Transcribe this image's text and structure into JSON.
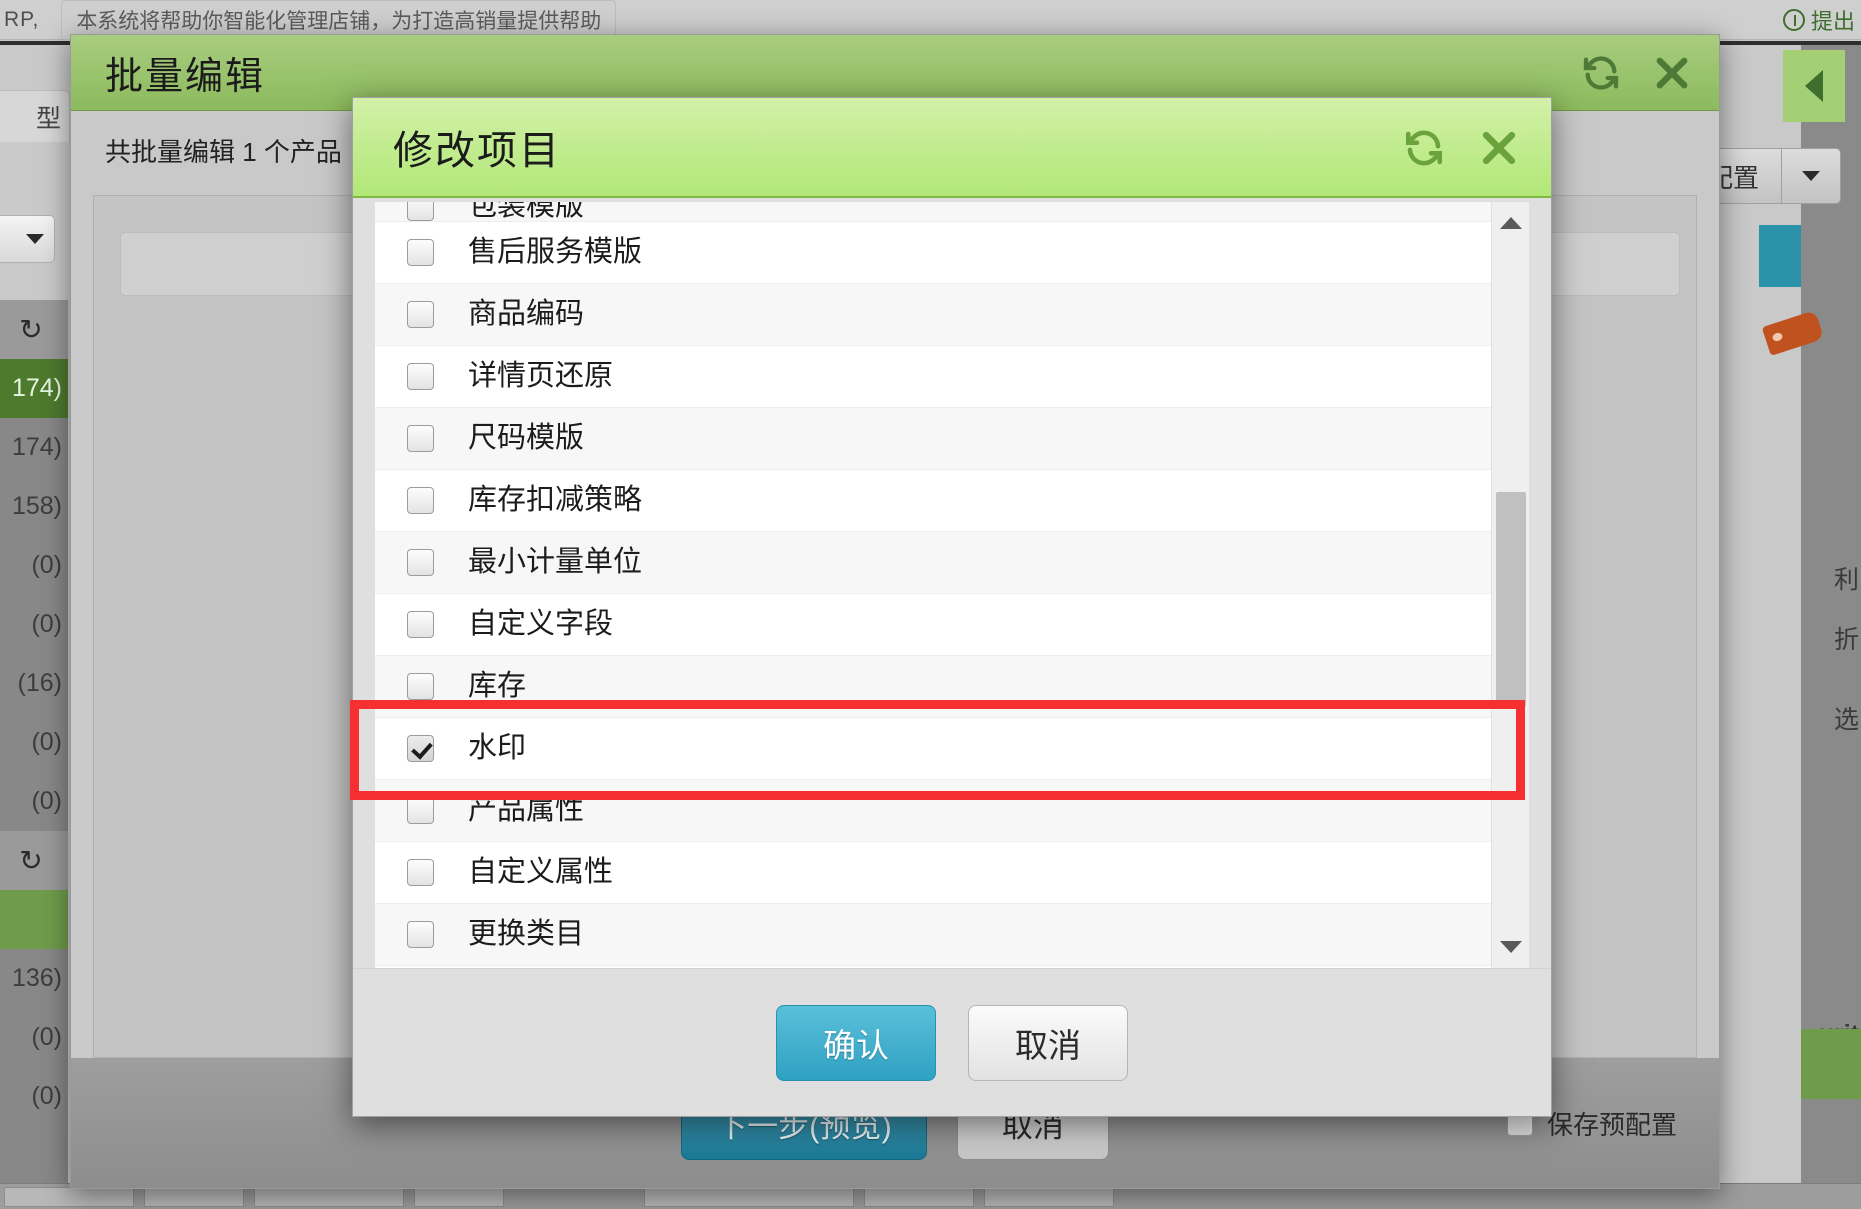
{
  "background": {
    "topbar": {
      "left_text": "RP,",
      "mid_text": "本系统将帮助你智能化管理店铺，为打造高销量提供帮助",
      "right_text": "提出",
      "right_icon": "help-circle-icon"
    },
    "tab_label": "型",
    "left_counts": [
      "174)",
      "174)",
      "158)",
      "(0)",
      "(0)",
      "(16)",
      "(0)",
      "(0)"
    ],
    "left_counts_2": [
      "136)",
      "(0)",
      "(0)"
    ],
    "refresh_icon": "refresh-icon",
    "right_labels": [
      "利",
      "折",
      "选"
    ],
    "right_footer_text": "urit",
    "save_preset_button": {
      "label": "保存预设配置",
      "dropdown_icon": "chevron-down-icon"
    }
  },
  "outer_modal": {
    "title": "批量编辑",
    "refresh_icon": "refresh-icon",
    "close_icon": "close-icon",
    "subtitle": "共批量编辑 1 个产品",
    "footer": {
      "next_label": "下一步(预览)",
      "cancel_label": "取消",
      "save_preset_checkbox_label": "保存预配置",
      "save_preset_checked": false
    }
  },
  "inner_modal": {
    "title": "修改项目",
    "refresh_icon": "refresh-icon",
    "close_icon": "close-icon",
    "items": [
      {
        "label": "包装模版",
        "checked": false,
        "clipped": true
      },
      {
        "label": "售后服务模版",
        "checked": false
      },
      {
        "label": "商品编码",
        "checked": false
      },
      {
        "label": "详情页还原",
        "checked": false
      },
      {
        "label": "尺码模版",
        "checked": false
      },
      {
        "label": "库存扣减策略",
        "checked": false
      },
      {
        "label": "最小计量单位",
        "checked": false
      },
      {
        "label": "自定义字段",
        "checked": false
      },
      {
        "label": "库存",
        "checked": false
      },
      {
        "label": "水印",
        "checked": true
      },
      {
        "label": "产品属性",
        "checked": false
      },
      {
        "label": "自定义属性",
        "checked": false
      },
      {
        "label": "更换类目",
        "checked": false
      }
    ],
    "scrollbar": {
      "up_icon": "triangle-up-icon",
      "down_icon": "triangle-down-icon",
      "thumb": "scroll-thumb"
    },
    "footer": {
      "confirm_label": "确认",
      "cancel_label": "取消"
    }
  },
  "annotation": {
    "highlight_color": "#f63030",
    "highlight_target": "水印"
  }
}
